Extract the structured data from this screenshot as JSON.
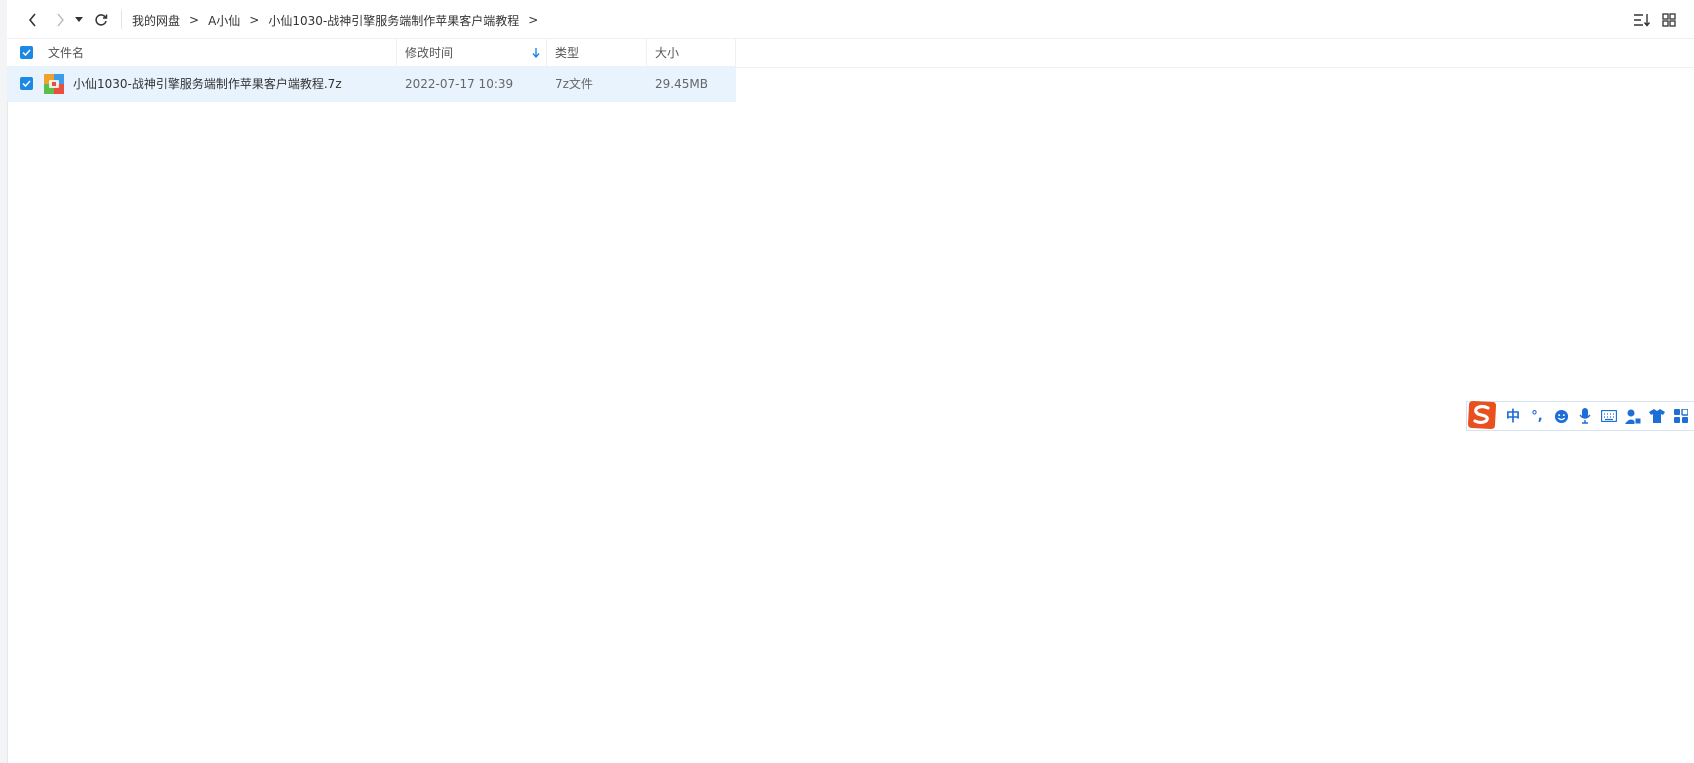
{
  "breadcrumb": {
    "items": [
      "我的网盘",
      "A小仙",
      "小仙1030-战神引擎服务端制作苹果客户端教程"
    ],
    "separator": ">"
  },
  "columns": {
    "name": "文件名",
    "modified": "修改时间",
    "type": "类型",
    "size": "大小"
  },
  "files": [
    {
      "name": "小仙1030-战神引擎服务端制作苹果客户端教程.7z",
      "modified": "2022-07-17 10:39",
      "type": "7z文件",
      "size": "29.45MB",
      "checked": true,
      "icon": "archive-7z-icon"
    }
  ],
  "ime": {
    "mode_label": "中",
    "punct_label": "°,",
    "items": [
      "sogou-logo-icon",
      "chinese-mode",
      "punctuation-mode",
      "emoji-icon",
      "microphone-icon",
      "keyboard-icon",
      "user-icon",
      "skin-shirt-icon",
      "toolbox-icon"
    ]
  },
  "colors": {
    "accent": "#1e88e5",
    "selected_row": "#e8f3fd",
    "ime_blue": "#1d6ed6",
    "ime_logo": "#e8501f"
  }
}
